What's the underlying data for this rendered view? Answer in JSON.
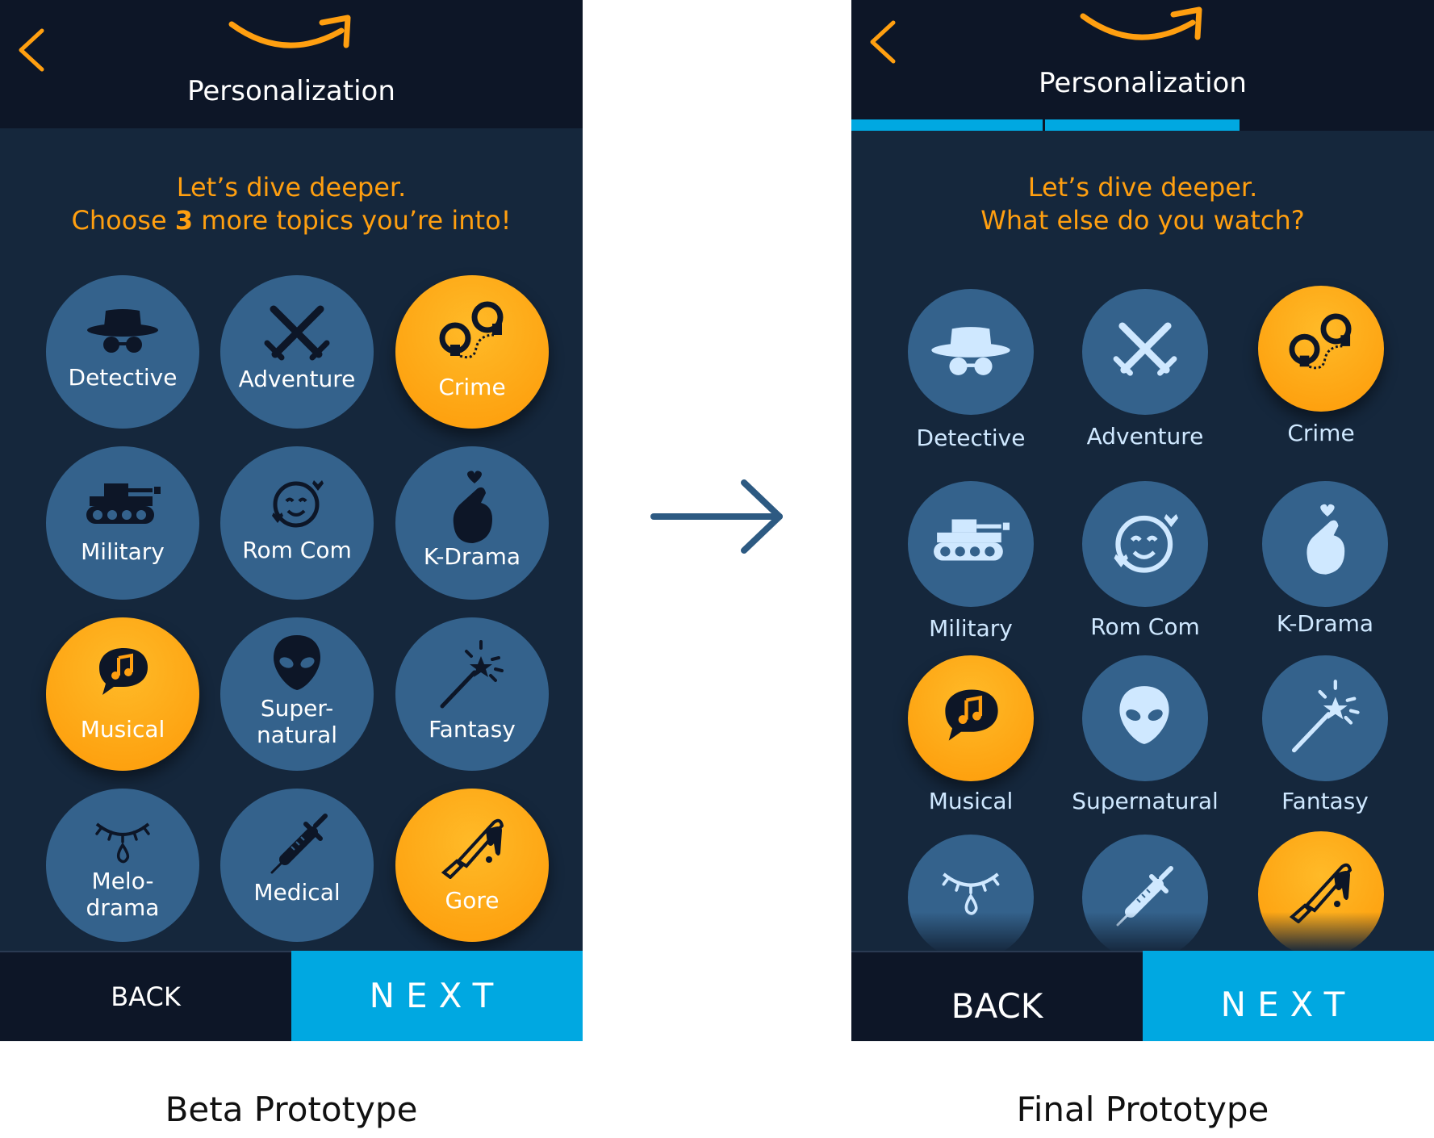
{
  "colors": {
    "accent_orange": "#ff9f10",
    "dark_bar": "#0d1627",
    "panel": "#15273c",
    "tile_blue": "#34628c",
    "next_blue": "#00a8e1"
  },
  "beta": {
    "title": "Personalization",
    "headline_line1": "Let’s dive deeper.",
    "headline_pre": "Choose ",
    "headline_count": "3",
    "headline_post": " more topics you’re into!",
    "topics": [
      {
        "label": "Detective",
        "icon": "detective-icon",
        "selected": false
      },
      {
        "label": "Adventure",
        "icon": "swords-icon",
        "selected": false
      },
      {
        "label": "Crime",
        "icon": "handcuffs-icon",
        "selected": true
      },
      {
        "label": "Military",
        "icon": "tank-icon",
        "selected": false
      },
      {
        "label": "Rom Com",
        "icon": "love-face-icon",
        "selected": false
      },
      {
        "label": "K-Drama",
        "icon": "finger-heart-icon",
        "selected": false
      },
      {
        "label": "Musical",
        "icon": "music-bubble-icon",
        "selected": true
      },
      {
        "label_line1": "Super-",
        "label_line2": "natural",
        "icon": "alien-icon",
        "selected": false
      },
      {
        "label": "Fantasy",
        "icon": "magic-wand-icon",
        "selected": false
      },
      {
        "label_line1": "Melo-",
        "label_line2": "drama",
        "icon": "crying-eye-icon",
        "selected": false
      },
      {
        "label": "Medical",
        "icon": "syringe-icon",
        "selected": false
      },
      {
        "label": "Gore",
        "icon": "bloody-knife-icon",
        "selected": true
      }
    ],
    "back_label": "BACK",
    "next_label": "NEXT"
  },
  "final": {
    "title": "Personalization",
    "progress_steps": 3,
    "progress_done": 2,
    "headline_line1": "Let’s dive deeper.",
    "headline_line2": "What else do you watch?",
    "topics": [
      {
        "label": "Detective",
        "icon": "detective-icon",
        "selected": false
      },
      {
        "label": "Adventure",
        "icon": "swords-icon",
        "selected": false
      },
      {
        "label": "Crime",
        "icon": "handcuffs-icon",
        "selected": true
      },
      {
        "label": "Military",
        "icon": "tank-icon",
        "selected": false
      },
      {
        "label": "Rom Com",
        "icon": "love-face-icon",
        "selected": false
      },
      {
        "label": "K-Drama",
        "icon": "finger-heart-icon",
        "selected": false
      },
      {
        "label": "Musical",
        "icon": "music-bubble-icon",
        "selected": true
      },
      {
        "label": "Supernatural",
        "icon": "alien-icon",
        "selected": false
      },
      {
        "label": "Fantasy",
        "icon": "magic-wand-icon",
        "selected": false
      },
      {
        "label": "",
        "icon": "crying-eye-icon",
        "selected": false
      },
      {
        "label": "",
        "icon": "syringe-icon",
        "selected": false
      },
      {
        "label": "",
        "icon": "bloody-knife-icon",
        "selected": true
      }
    ],
    "back_label": "BACK",
    "next_label": "NEXT"
  },
  "arrow_icon": "right-arrow-icon",
  "captions": {
    "beta": "Beta Prototype",
    "final": "Final Prototype"
  }
}
